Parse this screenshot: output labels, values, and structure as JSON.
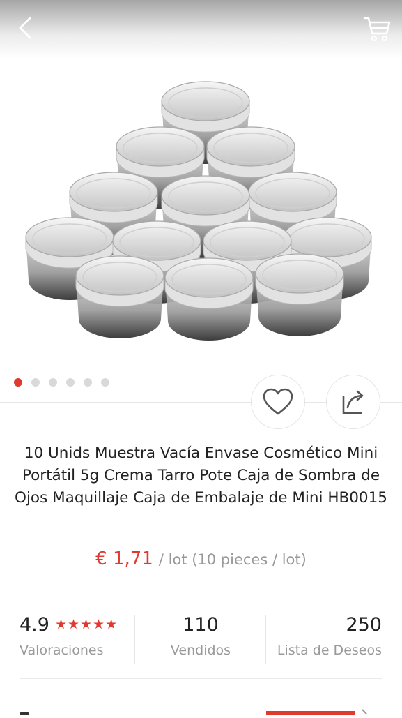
{
  "product": {
    "title": "10 Unids Muestra Vacía Envase Cosmético Mini Portátil 5g Crema Tarro Pote Caja de Sombra de Ojos Maquillaje Caja de Embalaje de Mini HB0015",
    "price": "€ 1,71",
    "price_unit": "/ lot (10 pieces / lot)",
    "image_count": 6,
    "active_image_index": 0
  },
  "stats": {
    "rating": "4.9",
    "stars": "★★★★★",
    "rating_label": "Valoraciones",
    "sold": "110",
    "sold_label": "Vendidos",
    "wishlist": "250",
    "wishlist_label": "Lista de Deseos"
  },
  "icons": {
    "back": "chevron-left-icon",
    "cart": "cart-icon",
    "wish": "heart-icon",
    "share": "share-icon"
  },
  "colors": {
    "accent": "#e03a30",
    "muted_text": "#999999"
  }
}
